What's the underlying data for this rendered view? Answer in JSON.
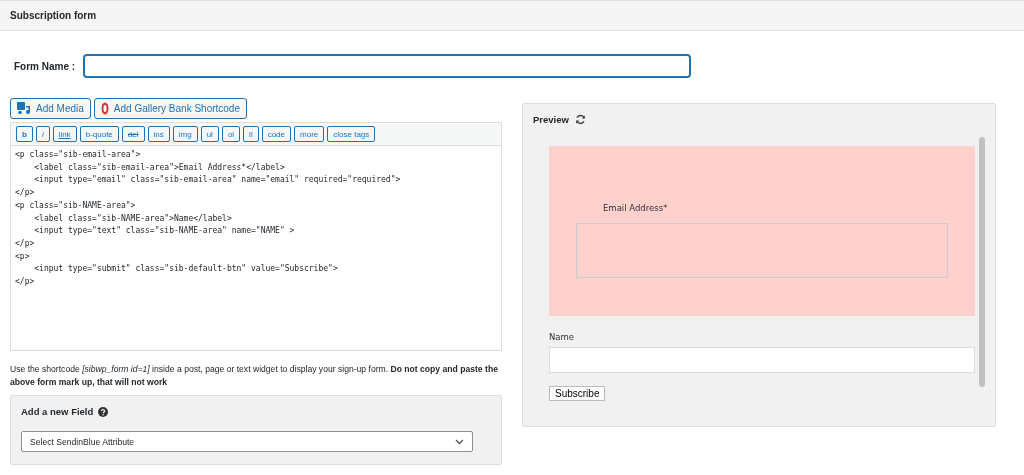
{
  "header": {
    "title": "Subscription form"
  },
  "form_name": {
    "label": "Form Name :"
  },
  "media_buttons": [
    {
      "label": "Add Media",
      "kind": "media"
    },
    {
      "label": "Add Gallery Bank Shortcode",
      "kind": "gallery"
    }
  ],
  "quicktags": [
    "b",
    "i",
    "link",
    "b-quote",
    "del",
    "ins",
    "img",
    "ul",
    "ol",
    "li",
    "code",
    "more",
    "close tags"
  ],
  "code_lines": [
    "<p class=\"sib-email-area\">",
    "    <label class=\"sib-email-area\">Email Address*</label>",
    "    <input type=\"email\" class=\"sib-email-area\" name=\"email\" required=\"required\">",
    "</p>",
    "<p class=\"sib-NAME-area\">",
    "    <label class=\"sib-NAME-area\">Name</label>",
    "    <input type=\"text\" class=\"sib-NAME-area\" name=\"NAME\" >",
    "</p>",
    "<p>",
    "    <input type=\"submit\" class=\"sib-default-btn\" value=\"Subscribe\">",
    "</p>"
  ],
  "help_text": "Use the shortcode *[sibwp_form id=1]* inside a post, page or text widget to display your sign-up form. **Do not copy and paste the above form mark up, that will not work**",
  "add_field": {
    "title": "Add a new Field",
    "select": "Select SendinBlue Attribute"
  },
  "preview": {
    "title": "Preview",
    "email_label": "Email Address*",
    "name_label": "Name",
    "submit": "Subscribe"
  }
}
